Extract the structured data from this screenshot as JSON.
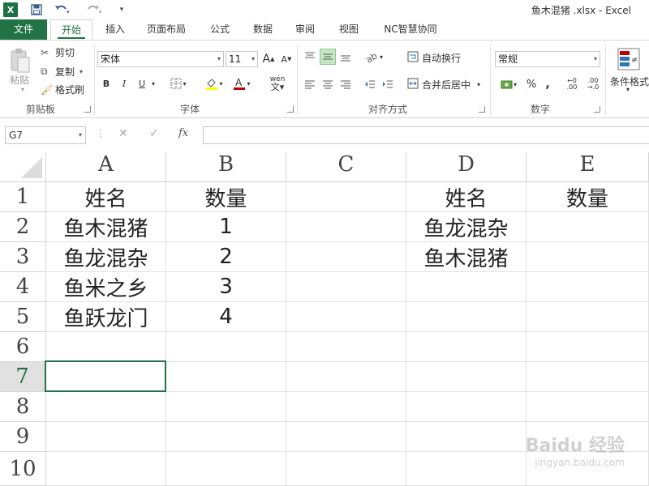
{
  "app": {
    "title": "鱼木混猪 .xlsx - Excel",
    "logo_text": "X"
  },
  "tabs": [
    "文件",
    "开始",
    "插入",
    "页面布局",
    "公式",
    "数据",
    "审阅",
    "视图",
    "NC智慧协同"
  ],
  "ribbon": {
    "clipboard": {
      "paste": "粘贴",
      "cut": "剪切",
      "copy": "复制",
      "format_painter": "格式刷",
      "label": "剪贴板"
    },
    "font": {
      "name": "宋体",
      "size": "11",
      "bold": "B",
      "italic": "I",
      "underline": "U",
      "wen": "wén",
      "label": "字体"
    },
    "alignment": {
      "wrap_text": "自动换行",
      "merge_center": "合并后居中",
      "label": "对齐方式"
    },
    "number": {
      "format": "常规",
      "label": "数字"
    },
    "styles": {
      "conditional_format": "条件格式"
    }
  },
  "formula_bar": {
    "name_box": "G7",
    "content": ""
  },
  "columns": [
    "A",
    "B",
    "C",
    "D",
    "E"
  ],
  "rows": [
    "1",
    "2",
    "3",
    "4",
    "5",
    "6",
    "7",
    "8",
    "9",
    "10"
  ],
  "cells": {
    "A1": "姓名",
    "B1": "数量",
    "D1": "姓名",
    "E1": "数量",
    "A2": "鱼木混猪",
    "B2": "1",
    "D2": "鱼龙混杂",
    "A3": "鱼龙混杂",
    "B3": "2",
    "D3": "鱼木混猪",
    "A4": "鱼米之乡",
    "B4": "3",
    "A5": "鱼跃龙门",
    "B5": "4"
  },
  "selected_cell": "G7",
  "watermark": {
    "line1": "Baidu 经验",
    "line2": "jingyan.baidu.com"
  },
  "colors": {
    "accent": "#217346"
  }
}
